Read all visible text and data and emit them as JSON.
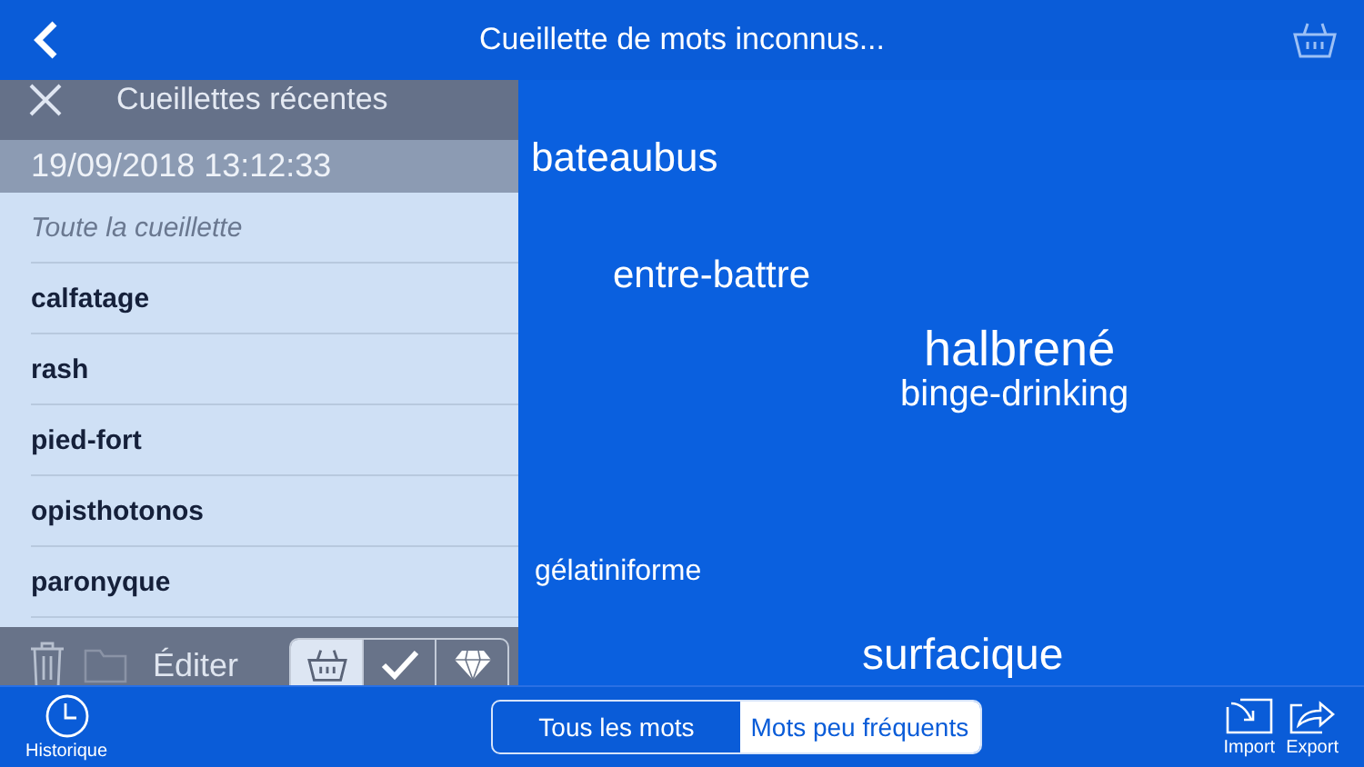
{
  "nav_bar": {
    "title": "Cueillette de mots inconnus..."
  },
  "word_cloud": [
    "bateaubus",
    "entre-battre",
    "halbrené",
    "binge-drinking",
    "gélatiniforme",
    "surfacique"
  ],
  "recent_panel": {
    "title": "Cueillettes récentes",
    "date": "19/09/2018 13:12:33",
    "items": [
      {
        "label": "Toute la cueillette",
        "kind": "all"
      },
      {
        "label": "calfatage",
        "kind": "word"
      },
      {
        "label": "rash",
        "kind": "word"
      },
      {
        "label": "pied-fort",
        "kind": "word"
      },
      {
        "label": "opisthotonos",
        "kind": "word"
      },
      {
        "label": "paronyque",
        "kind": "word"
      }
    ],
    "edit_label": "Éditer",
    "filters": [
      {
        "kind": "basket",
        "selected": true
      },
      {
        "kind": "check",
        "selected": false
      },
      {
        "kind": "diamond",
        "selected": false
      }
    ]
  },
  "bottom_bar": {
    "history_label": "Historique",
    "segments": [
      {
        "label": "Tous les mots",
        "selected": false
      },
      {
        "label": "Mots peu fréquents",
        "selected": true
      }
    ],
    "import_label": "Import",
    "export_label": "Export"
  }
}
